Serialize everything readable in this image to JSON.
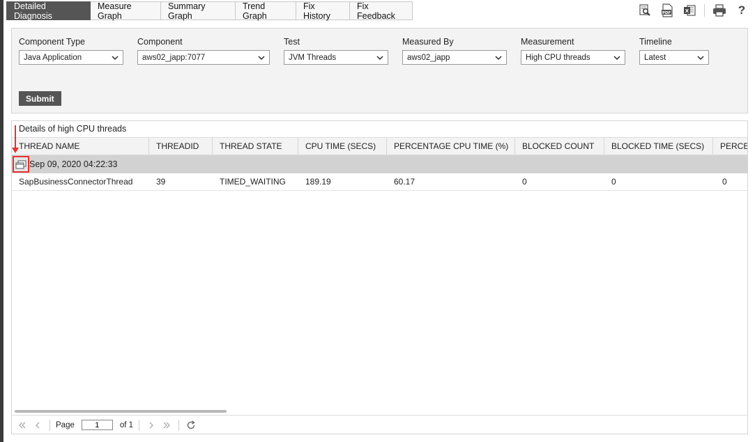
{
  "tabs": [
    {
      "label": "Detailed Diagnosis",
      "active": true
    },
    {
      "label": "Measure Graph",
      "active": false
    },
    {
      "label": "Summary Graph",
      "active": false
    },
    {
      "label": "Trend Graph",
      "active": false
    },
    {
      "label": "Fix History",
      "active": false
    },
    {
      "label": "Fix Feedback",
      "active": false
    }
  ],
  "toolbar": {
    "icons": [
      "search-report-icon",
      "pdf-icon",
      "excel-icon",
      "print-icon",
      "help-icon"
    ],
    "help_label": "?"
  },
  "filters": {
    "component_type": {
      "label": "Component Type",
      "value": "Java Application"
    },
    "component": {
      "label": "Component",
      "value": "aws02_japp:7077"
    },
    "test": {
      "label": "Test",
      "value": "JVM Threads"
    },
    "measured_by": {
      "label": "Measured By",
      "value": "aws02_japp"
    },
    "measurement": {
      "label": "Measurement",
      "value": "High CPU threads"
    },
    "timeline": {
      "label": "Timeline",
      "value": "Latest"
    },
    "submit_label": "Submit"
  },
  "grid": {
    "caption": "Details of high CPU threads",
    "columns": [
      "THREAD NAME",
      "THREADID",
      "THREAD STATE",
      "CPU TIME (SECS)",
      "PERCENTAGE CPU TIME (%)",
      "BLOCKED COUNT",
      "BLOCKED TIME (SECS)",
      "PERCEN"
    ],
    "group_label": "Sep 09, 2020 04:22:33",
    "row": [
      "SapBusinessConnectorThread",
      "39",
      "TIMED_WAITING",
      "189.19",
      "60.17",
      "0",
      "0",
      "0"
    ]
  },
  "pager": {
    "page_label": "Page",
    "page_value": "1",
    "of_label": "of 1"
  },
  "colors": {
    "active_tab": "#555555",
    "highlight": "#e3342f",
    "panel_bg": "#f3f3f3",
    "group_row_bg": "#d2d2d2"
  }
}
